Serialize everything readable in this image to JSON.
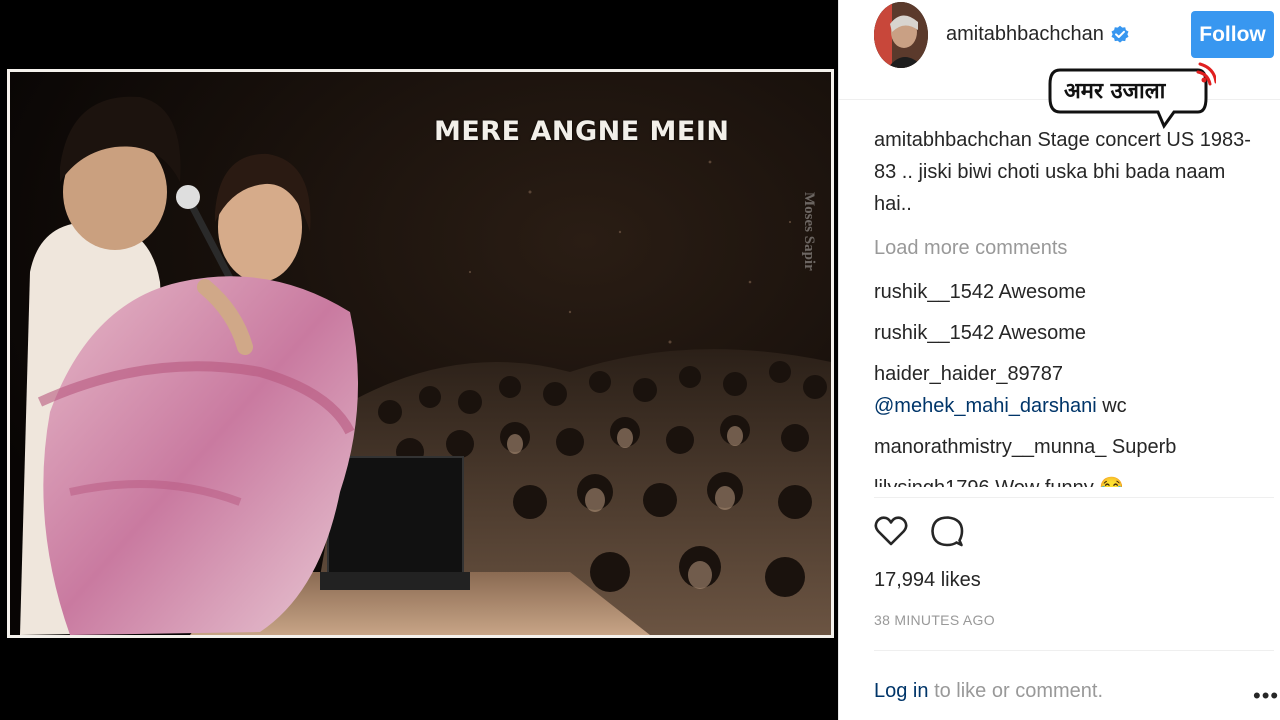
{
  "media": {
    "caption": "MERE ANGNE MEIN",
    "watermark": "Moses Sapir"
  },
  "post": {
    "username": "amitabhbachchan",
    "verified": true,
    "follow_label": "Follow",
    "caption_user": "amitabhbachchan",
    "caption_text": "Stage concert US 1983-83 .. jiski biwi choti uska bhi bada naam hai..",
    "load_more": "Load more comments",
    "comments": [
      {
        "user": "rushik__1542",
        "text": "Awesome"
      },
      {
        "user": "rushik__1542",
        "text": "Awesome"
      },
      {
        "user": "haider_haider_89787",
        "mention": "@mehek_mahi_darshani",
        "text": "wc"
      },
      {
        "user": "manorathmistry__munna_",
        "text": "Superb"
      },
      {
        "user": "lilysingh1796",
        "text": "Wow funny 😂"
      }
    ],
    "likes": "17,994 likes",
    "timestamp": "38 MINUTES AGO",
    "login_link": "Log in",
    "login_suffix": "to like or comment.",
    "more_label": "•••"
  },
  "logo": {
    "text": "अमर उजाला"
  },
  "colors": {
    "follow_blue": "#3897f0",
    "link_blue": "#003569",
    "muted_gray": "#999999",
    "text_dark": "#262626"
  },
  "icons": [
    "verified-icon",
    "heart-icon",
    "comment-icon",
    "more-options-icon"
  ]
}
